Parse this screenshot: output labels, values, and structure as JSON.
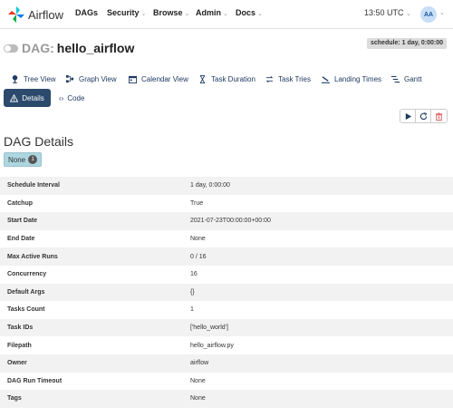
{
  "nav": {
    "brand": "Airflow",
    "items": [
      {
        "label": "DAGs",
        "caret": false
      },
      {
        "label": "Security",
        "caret": true
      },
      {
        "label": "Browse",
        "caret": true
      },
      {
        "label": "Admin",
        "caret": true
      },
      {
        "label": "Docs",
        "caret": true
      }
    ],
    "time": "13:50 UTC",
    "avatar": "AA"
  },
  "header": {
    "prefix": "DAG:",
    "dag_id": "hello_airflow",
    "schedule": "schedule: 1 day, 0:00:00"
  },
  "tabs": [
    {
      "label": "Tree View",
      "icon": "tree-icon"
    },
    {
      "label": "Graph View",
      "icon": "graph-icon"
    },
    {
      "label": "Calendar View",
      "icon": "calendar-icon"
    },
    {
      "label": "Task Duration",
      "icon": "hourglass-icon"
    },
    {
      "label": "Task Tries",
      "icon": "retry-icon"
    },
    {
      "label": "Landing Times",
      "icon": "landing-icon"
    },
    {
      "label": "Gantt",
      "icon": "gantt-icon"
    },
    {
      "label": "Details",
      "icon": "warning-icon",
      "active": true
    },
    {
      "label": "Code",
      "icon": "code-icon"
    }
  ],
  "actions": [
    "play-icon",
    "refresh-icon",
    "trash-icon"
  ],
  "section_title": "DAG Details",
  "state": {
    "label": "None",
    "count": "1"
  },
  "details": [
    {
      "key": "Schedule Interval",
      "value": "1 day, 0:00:00"
    },
    {
      "key": "Catchup",
      "value": "True"
    },
    {
      "key": "Start Date",
      "value": "2021-07-23T00:00:00+00:00"
    },
    {
      "key": "End Date",
      "value": "None"
    },
    {
      "key": "Max Active Runs",
      "value": "0 / 16"
    },
    {
      "key": "Concurrency",
      "value": "16"
    },
    {
      "key": "Default Args",
      "value": "{}"
    },
    {
      "key": "Tasks Count",
      "value": "1"
    },
    {
      "key": "Task IDs",
      "value": "['hello_world']"
    },
    {
      "key": "Filepath",
      "value": "hello_airflow.py"
    },
    {
      "key": "Owner",
      "value": "airflow"
    },
    {
      "key": "DAG Run Timeout",
      "value": "None"
    },
    {
      "key": "Tags",
      "value": "None"
    }
  ],
  "colors": {
    "accent": "#2b4a6c",
    "link": "#1f3a60",
    "state_none": "#acd6e0",
    "danger": "#d9534f"
  }
}
